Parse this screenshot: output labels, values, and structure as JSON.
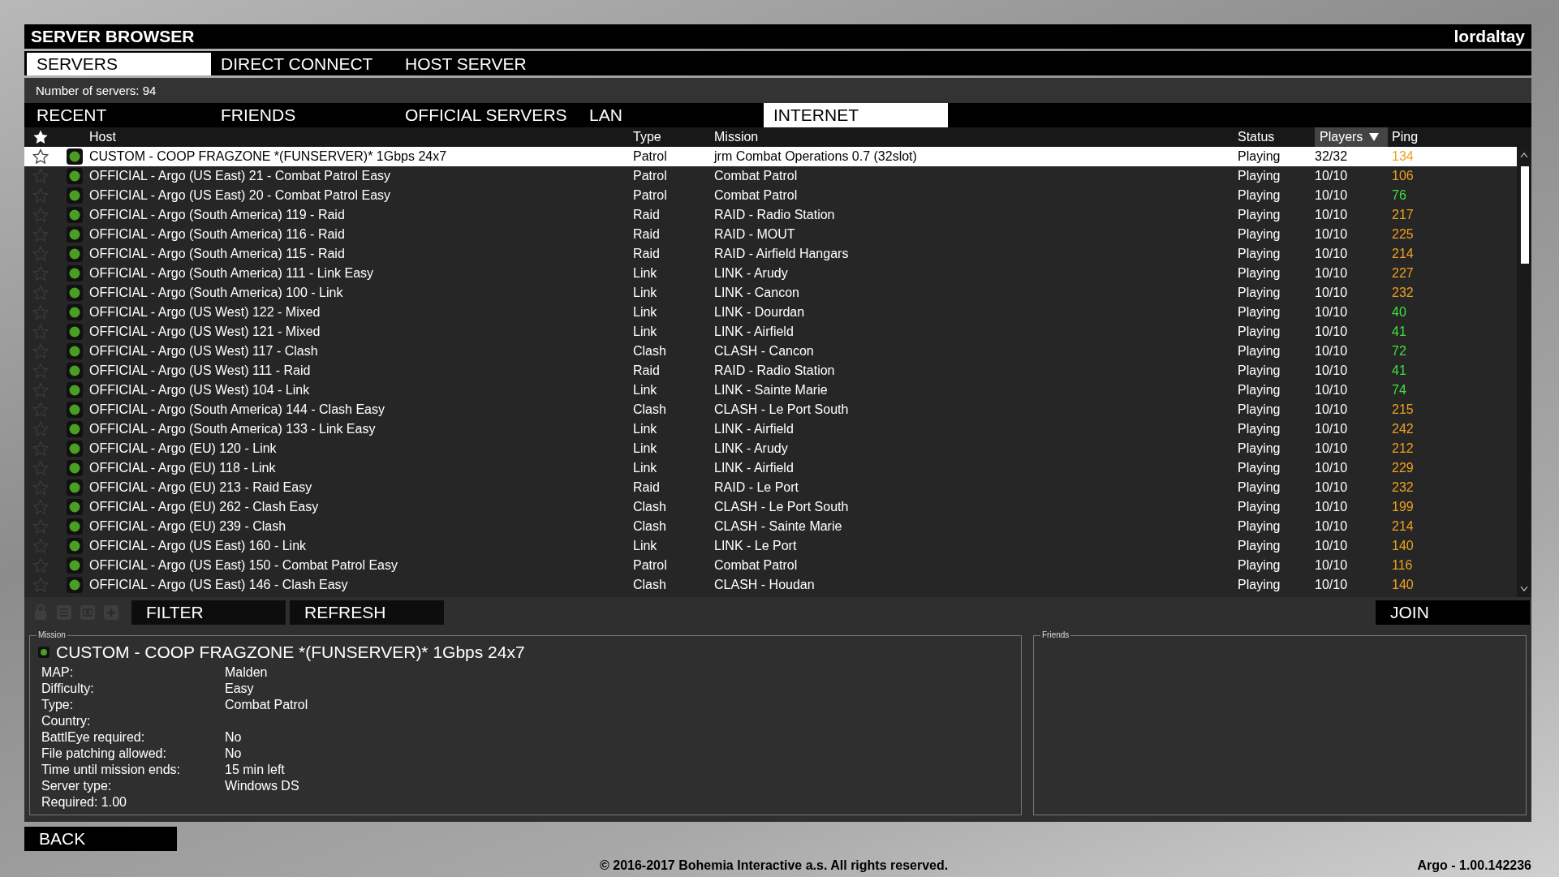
{
  "window": {
    "title": "SERVER BROWSER",
    "user": "lordaltay"
  },
  "tabs": [
    {
      "label": "SERVERS",
      "selected": true
    },
    {
      "label": "DIRECT CONNECT",
      "selected": false
    },
    {
      "label": "HOST SERVER",
      "selected": false
    }
  ],
  "server_count": "Number of servers: 94",
  "filter_tabs": [
    {
      "label": "RECENT",
      "selected": false
    },
    {
      "label": "FRIENDS",
      "selected": false
    },
    {
      "label": "OFFICIAL SERVERS",
      "selected": false
    },
    {
      "label": "LAN",
      "selected": false
    },
    {
      "label": "INTERNET",
      "selected": true
    }
  ],
  "table": {
    "columns": [
      {
        "label": "Host",
        "sorted": false
      },
      {
        "label": "Type",
        "sorted": false
      },
      {
        "label": "Mission",
        "sorted": false
      },
      {
        "label": "Status",
        "sorted": false
      },
      {
        "label": "Players",
        "sorted": true
      },
      {
        "label": "Ping",
        "sorted": false
      }
    ],
    "rows": [
      {
        "host": "CUSTOM - COOP FRAGZONE *(FUNSERVER)* 1Gbps 24x7",
        "type": "Patrol",
        "mission": "jrm Combat Operations 0.7 (32slot)",
        "status": "Playing",
        "players": "32/32",
        "ping": "134",
        "color": "#f0a020",
        "favorite": false,
        "selected": true
      },
      {
        "host": "OFFICIAL - Argo (US East) 21 - Combat Patrol Easy",
        "type": "Patrol",
        "mission": "Combat Patrol",
        "status": "Playing",
        "players": "10/10",
        "ping": "106",
        "color": "#f0a020",
        "favorite": false,
        "selected": false
      },
      {
        "host": "OFFICIAL - Argo (US East) 20 - Combat Patrol Easy",
        "type": "Patrol",
        "mission": "Combat Patrol",
        "status": "Playing",
        "players": "10/10",
        "ping": "76",
        "color": "#3ee03e",
        "favorite": false,
        "selected": false
      },
      {
        "host": "OFFICIAL - Argo (South America) 119 - Raid",
        "type": "Raid",
        "mission": "RAID - Radio Station",
        "status": "Playing",
        "players": "10/10",
        "ping": "217",
        "color": "#f0a020",
        "favorite": false,
        "selected": false
      },
      {
        "host": "OFFICIAL - Argo (South America) 116 - Raid",
        "type": "Raid",
        "mission": "RAID - MOUT",
        "status": "Playing",
        "players": "10/10",
        "ping": "225",
        "color": "#f0a020",
        "favorite": false,
        "selected": false
      },
      {
        "host": "OFFICIAL - Argo (South America) 115 - Raid",
        "type": "Raid",
        "mission": "RAID - Airfield Hangars",
        "status": "Playing",
        "players": "10/10",
        "ping": "214",
        "color": "#f0a020",
        "favorite": false,
        "selected": false
      },
      {
        "host": "OFFICIAL - Argo (South America) 111 - Link Easy",
        "type": "Link",
        "mission": "LINK - Arudy",
        "status": "Playing",
        "players": "10/10",
        "ping": "227",
        "color": "#f0a020",
        "favorite": false,
        "selected": false
      },
      {
        "host": "OFFICIAL - Argo (South America) 100 - Link",
        "type": "Link",
        "mission": "LINK - Cancon",
        "status": "Playing",
        "players": "10/10",
        "ping": "232",
        "color": "#f0a020",
        "favorite": false,
        "selected": false
      },
      {
        "host": "OFFICIAL - Argo (US West) 122 - Mixed",
        "type": "Link",
        "mission": "LINK - Dourdan",
        "status": "Playing",
        "players": "10/10",
        "ping": "40",
        "color": "#3ee03e",
        "favorite": false,
        "selected": false
      },
      {
        "host": "OFFICIAL - Argo (US West) 121 - Mixed",
        "type": "Link",
        "mission": "LINK - Airfield",
        "status": "Playing",
        "players": "10/10",
        "ping": "41",
        "color": "#3ee03e",
        "favorite": false,
        "selected": false
      },
      {
        "host": "OFFICIAL - Argo (US West) 117 - Clash",
        "type": "Clash",
        "mission": "CLASH - Cancon",
        "status": "Playing",
        "players": "10/10",
        "ping": "72",
        "color": "#3ee03e",
        "favorite": false,
        "selected": false
      },
      {
        "host": "OFFICIAL - Argo (US West) 111 - Raid",
        "type": "Raid",
        "mission": "RAID - Radio Station",
        "status": "Playing",
        "players": "10/10",
        "ping": "41",
        "color": "#3ee03e",
        "favorite": false,
        "selected": false
      },
      {
        "host": "OFFICIAL - Argo (US West) 104 - Link",
        "type": "Link",
        "mission": "LINK - Sainte Marie",
        "status": "Playing",
        "players": "10/10",
        "ping": "74",
        "color": "#3ee03e",
        "favorite": false,
        "selected": false
      },
      {
        "host": "OFFICIAL - Argo (South America) 144 - Clash Easy",
        "type": "Clash",
        "mission": "CLASH - Le Port South",
        "status": "Playing",
        "players": "10/10",
        "ping": "215",
        "color": "#f0a020",
        "favorite": false,
        "selected": false
      },
      {
        "host": "OFFICIAL - Argo (South America) 133 - Link Easy",
        "type": "Link",
        "mission": "LINK - Airfield",
        "status": "Playing",
        "players": "10/10",
        "ping": "242",
        "color": "#f0a020",
        "favorite": false,
        "selected": false
      },
      {
        "host": "OFFICIAL - Argo (EU) 120 - Link",
        "type": "Link",
        "mission": "LINK - Arudy",
        "status": "Playing",
        "players": "10/10",
        "ping": "212",
        "color": "#f0a020",
        "favorite": false,
        "selected": false
      },
      {
        "host": "OFFICIAL - Argo (EU) 118 - Link",
        "type": "Link",
        "mission": "LINK - Airfield",
        "status": "Playing",
        "players": "10/10",
        "ping": "229",
        "color": "#f0a020",
        "favorite": false,
        "selected": false
      },
      {
        "host": "OFFICIAL - Argo (EU) 213 - Raid Easy",
        "type": "Raid",
        "mission": "RAID - Le Port",
        "status": "Playing",
        "players": "10/10",
        "ping": "232",
        "color": "#f0a020",
        "favorite": false,
        "selected": false
      },
      {
        "host": "OFFICIAL - Argo (EU) 262 - Clash Easy",
        "type": "Clash",
        "mission": "CLASH - Le Port South",
        "status": "Playing",
        "players": "10/10",
        "ping": "199",
        "color": "#f0a020",
        "favorite": false,
        "selected": false
      },
      {
        "host": "OFFICIAL - Argo (EU) 239 - Clash",
        "type": "Clash",
        "mission": "CLASH - Sainte Marie",
        "status": "Playing",
        "players": "10/10",
        "ping": "214",
        "color": "#f0a020",
        "favorite": false,
        "selected": false
      },
      {
        "host": "OFFICIAL - Argo (US East) 160 - Link",
        "type": "Link",
        "mission": "LINK - Le Port",
        "status": "Playing",
        "players": "10/10",
        "ping": "140",
        "color": "#f0a020",
        "favorite": false,
        "selected": false
      },
      {
        "host": "OFFICIAL - Argo (US East) 150 - Combat Patrol Easy",
        "type": "Patrol",
        "mission": "Combat Patrol",
        "status": "Playing",
        "players": "10/10",
        "ping": "116",
        "color": "#f0a020",
        "favorite": false,
        "selected": false
      },
      {
        "host": "OFFICIAL - Argo (US East) 146 - Clash Easy",
        "type": "Clash",
        "mission": "CLASH - Houdan",
        "status": "Playing",
        "players": "10/10",
        "ping": "140",
        "color": "#f0a020",
        "favorite": false,
        "selected": false
      }
    ]
  },
  "actions": [
    "FILTER",
    "REFRESH"
  ],
  "join": "JOIN",
  "details": {
    "legend": "Mission",
    "title": "CUSTOM - COOP FRAGZONE *(FUNSERVER)* 1Gbps 24x7",
    "fields": [
      {
        "label": "MAP:",
        "value": "Malden"
      },
      {
        "label": "Difficulty:",
        "value": "Easy"
      },
      {
        "label": "Type:",
        "value": "Combat Patrol"
      },
      {
        "label": "Country:"
      },
      {
        "label": "BattlEye required:",
        "value": "No"
      },
      {
        "label": "File patching allowed:",
        "value": "No"
      },
      {
        "label": "Time until mission ends:",
        "value": "15 min left"
      },
      {
        "label": "Server type:",
        "value": "Windows DS"
      },
      {
        "label": "Required: 1.00"
      }
    ]
  },
  "friends": {
    "legend": "Friends"
  },
  "back": "BACK",
  "footer": {
    "copyright": "© 2016-2017 Bohemia Interactive a.s. All rights reserved.",
    "version": "Argo - 1.00.142236"
  }
}
